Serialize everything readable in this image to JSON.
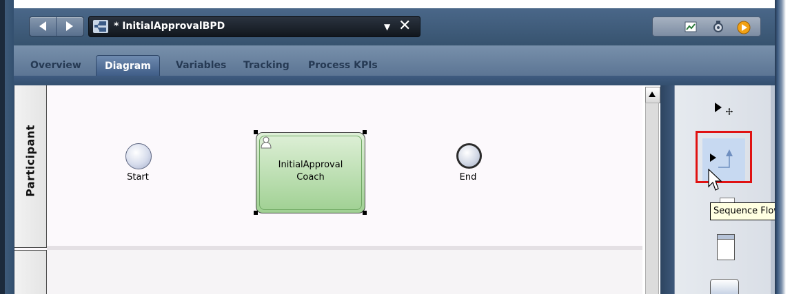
{
  "header": {
    "process_title": "* InitialApprovalBPD",
    "nav_back_icon": "back-arrow-icon",
    "nav_forward_icon": "forward-arrow-icon",
    "process_icon": "process-diagram-icon",
    "tools": [
      "performance-chart-icon",
      "debug-settings-icon",
      "play-icon"
    ]
  },
  "tabs": [
    {
      "label": "Overview",
      "active": false
    },
    {
      "label": "Diagram",
      "active": true
    },
    {
      "label": "Variables",
      "active": false
    },
    {
      "label": "Tracking",
      "active": false
    },
    {
      "label": "Process KPIs",
      "active": false
    }
  ],
  "diagram": {
    "lane_label": "Participant",
    "start_event_label": "Start",
    "coach_label": "InitialApproval Coach",
    "end_event_label": "End"
  },
  "palette": {
    "tooltip": "Sequence Flow",
    "items": [
      "selection-tool-icon",
      "sequence-flow-icon",
      "lane-icon",
      "activity-icon"
    ]
  },
  "colors": {
    "highlight": "#e01212",
    "coach_fill": "#9fd092",
    "selected_tool_bg": "#c7d9f1"
  }
}
